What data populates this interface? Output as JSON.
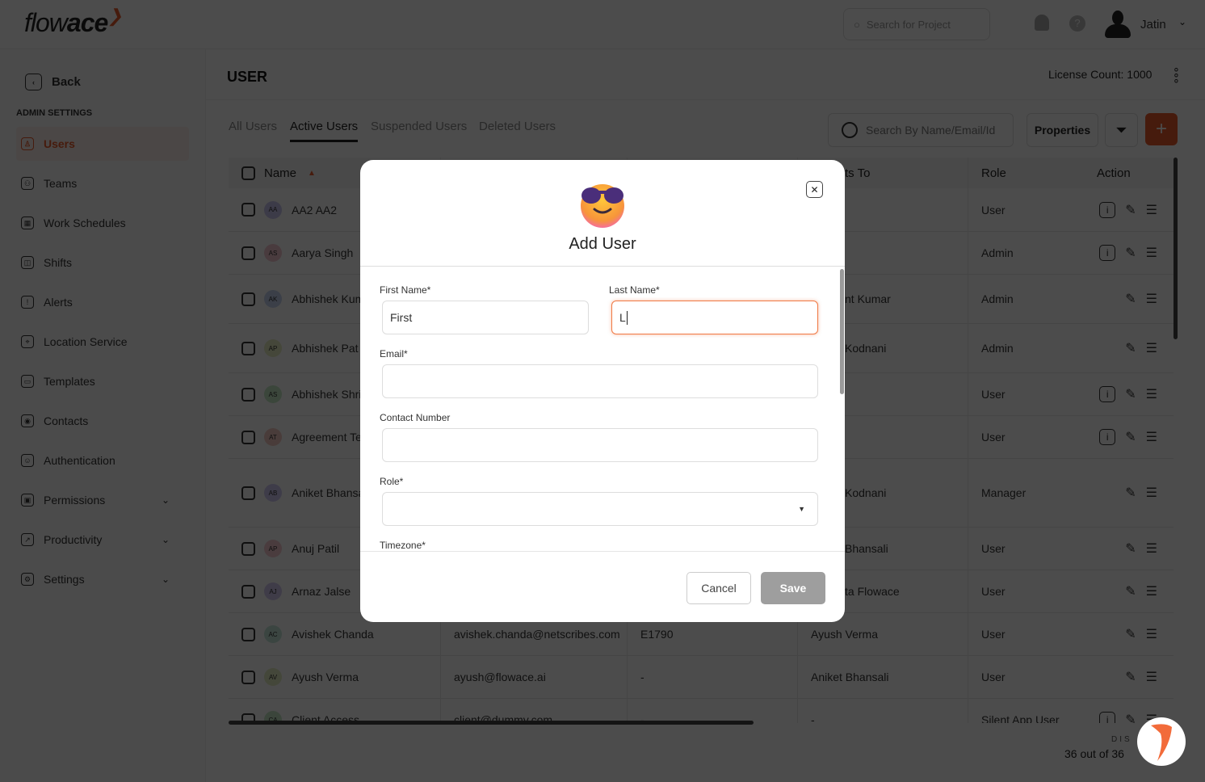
{
  "app": {
    "logo_light": "flow",
    "logo_bold": "ace",
    "project_search_placeholder": "Search for Project",
    "user_name": "Jatin"
  },
  "sidebar": {
    "back": "Back",
    "section": "ADMIN SETTINGS",
    "items": [
      {
        "label": "Users",
        "icon": "user-icon",
        "active": true
      },
      {
        "label": "Teams",
        "icon": "teams-icon"
      },
      {
        "label": "Work Schedules",
        "icon": "calendar-icon"
      },
      {
        "label": "Shifts",
        "icon": "shift-icon"
      },
      {
        "label": "Alerts",
        "icon": "alert-icon"
      },
      {
        "label": "Location Service",
        "icon": "location-icon"
      },
      {
        "label": "Templates",
        "icon": "folder-icon"
      },
      {
        "label": "Contacts",
        "icon": "contact-icon"
      },
      {
        "label": "Authentication",
        "icon": "auth-icon"
      },
      {
        "label": "Permissions",
        "icon": "lock-icon",
        "expandable": true
      },
      {
        "label": "Productivity",
        "icon": "productivity-icon",
        "expandable": true
      },
      {
        "label": "Settings",
        "icon": "settings-icon",
        "expandable": true
      }
    ]
  },
  "page": {
    "title": "USER",
    "license": "License Count: 1000",
    "tabs": [
      "All Users",
      "Active Users",
      "Suspended Users",
      "Deleted Users"
    ],
    "active_tab": 1,
    "search_placeholder": "Search By Name/Email/Id",
    "properties": "Properties",
    "add": "+",
    "footer_label": "DIS",
    "footer_count": "36 out of 36"
  },
  "table": {
    "headers": {
      "name": "Name",
      "reports": "ts To",
      "role": "Role",
      "action": "Action"
    },
    "rows": [
      {
        "initials": "AA",
        "avatar": "#c9c3ef",
        "name": "AA2 AA2",
        "email": "",
        "id": "",
        "reports": "",
        "role": "User",
        "info": true
      },
      {
        "initials": "AS",
        "avatar": "#f3c6cf",
        "name": "Aarya Singh",
        "email": "",
        "id": "",
        "reports": "",
        "role": "Admin",
        "info": true
      },
      {
        "initials": "AK",
        "avatar": "#c6d3ef",
        "name": "Abhishek Kum",
        "email": "",
        "id": "",
        "reports": "nt Kumar",
        "role": "Admin",
        "info": false
      },
      {
        "initials": "AP",
        "avatar": "#e5edc0",
        "name": "Abhishek Pat",
        "email": "",
        "id": "",
        "reports": "Kodnani",
        "role": "Admin",
        "info": false
      },
      {
        "initials": "AS",
        "avatar": "#c6e8c6",
        "name": "Abhishek Shri",
        "email": "",
        "id": "",
        "reports": "",
        "role": "User",
        "info": true
      },
      {
        "initials": "AT",
        "avatar": "#f3c9c0",
        "name": "Agreement Te",
        "email": "",
        "id": "",
        "reports": "",
        "role": "User",
        "info": true
      },
      {
        "initials": "AB",
        "avatar": "#cfc9f2",
        "name": "Aniket Bhansa",
        "email": "",
        "id": "",
        "reports": "Kodnani",
        "role": "Manager",
        "info": false
      },
      {
        "initials": "AP",
        "avatar": "#f5c8cf",
        "name": "Anuj Patil",
        "email": "",
        "id": "",
        "reports": "Bhansali",
        "role": "User",
        "info": false
      },
      {
        "initials": "AJ",
        "avatar": "#d2c8f0",
        "name": "Arnaz Jalse",
        "email": "",
        "id": "",
        "reports": "ta Flowace",
        "role": "User",
        "info": false
      },
      {
        "initials": "AC",
        "avatar": "#c3e6da",
        "name": "Avishek Chanda",
        "email": "avishek.chanda@netscribes.com",
        "id": "E1790",
        "reports": "Ayush Verma",
        "role": "User",
        "info": false
      },
      {
        "initials": "AV",
        "avatar": "#e4ecc2",
        "name": "Ayush Verma",
        "email": "ayush@flowace.ai",
        "id": "-",
        "reports": "Aniket Bhansali",
        "role": "User",
        "info": false
      },
      {
        "initials": "CA",
        "avatar": "#c3e6c6",
        "name": "Client Access",
        "email": "client@dummy.com",
        "id": "-",
        "reports": "-",
        "role": "Silent App User",
        "info": true
      }
    ]
  },
  "modal": {
    "title": "Add User",
    "first_label": "First Name*",
    "first_value": "First",
    "last_label": "Last Name*",
    "last_value": "L",
    "email_label": "Email*",
    "contact_label": "Contact Number",
    "role_label": "Role*",
    "timezone_label": "Timezone*",
    "cancel": "Cancel",
    "save": "Save"
  },
  "colors": {
    "accent": "#e85a2a",
    "focus": "#f07a45",
    "save_disabled": "#9e9e9e"
  }
}
